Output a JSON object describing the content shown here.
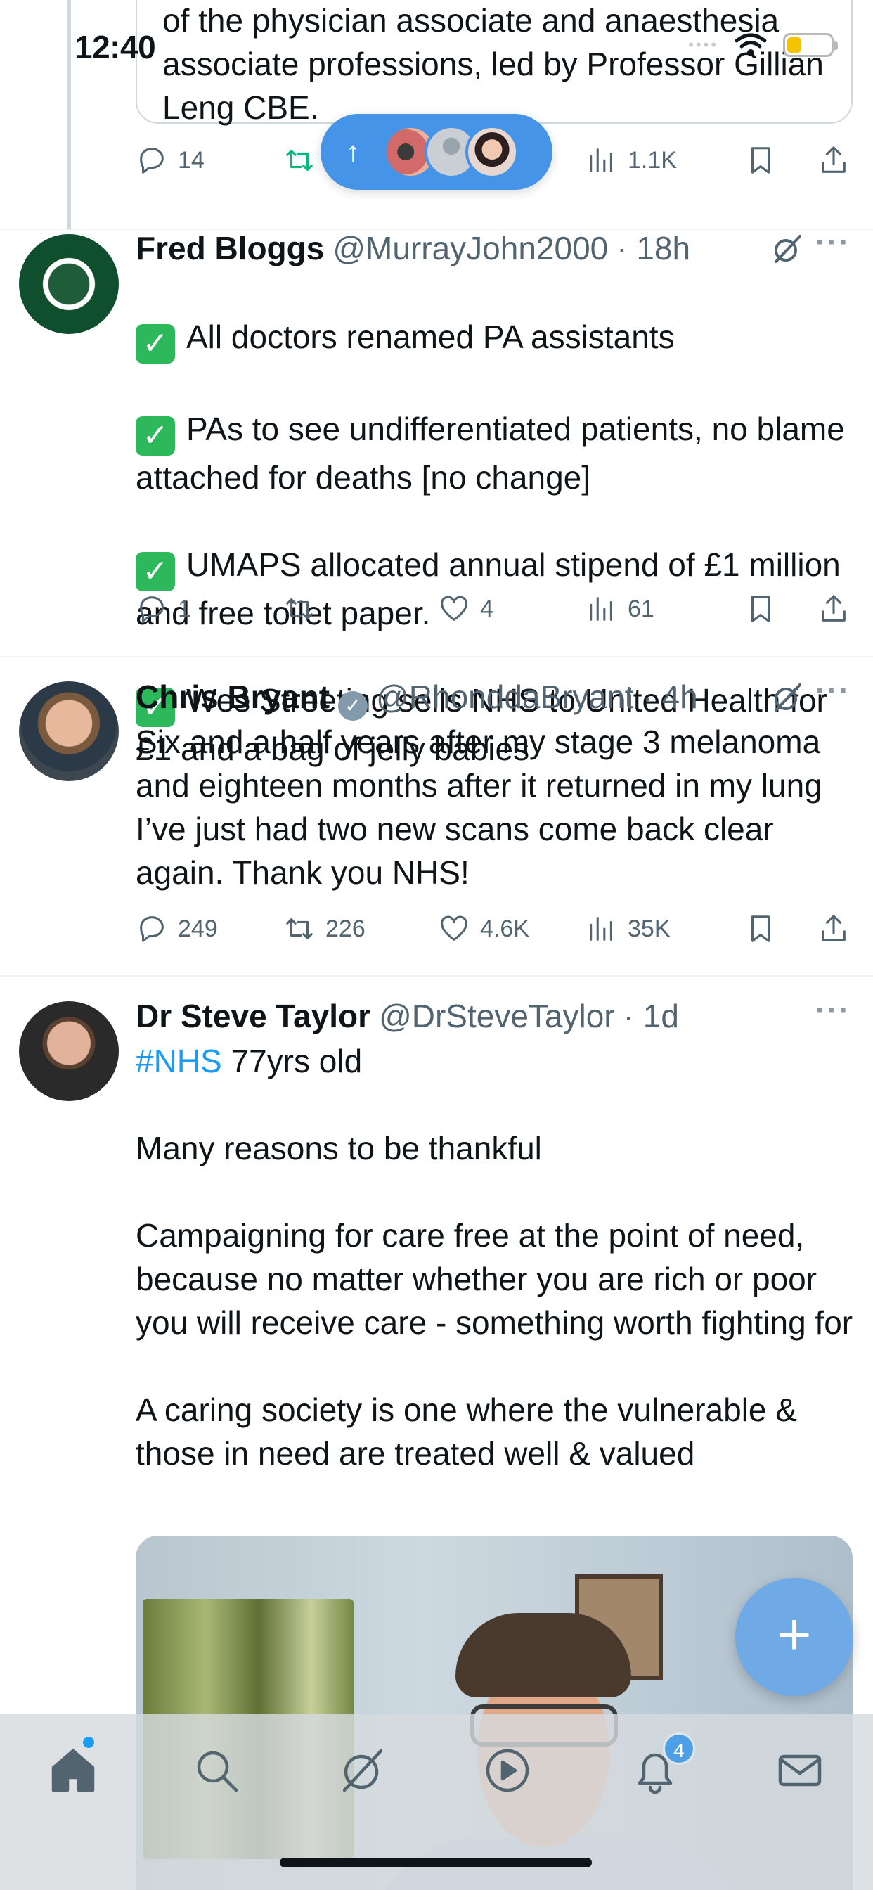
{
  "status_bar": {
    "time": "12:40"
  },
  "quoted_tweet": {
    "text": "of the physician associate and anaesthesia associate professions, led by Professor Gillian Leng CBE."
  },
  "quoted_actions": {
    "replies": "14",
    "views": "1.1K"
  },
  "new_posts_pill": {
    "arrow": "↑"
  },
  "posts": [
    {
      "name": "Fred Bloggs",
      "handle": "@MurrayJohn2000",
      "time": "· 18h",
      "lines": [
        "All doctors renamed PA assistants",
        "PAs to see undifferentiated patients, no blame attached for deaths [no change]",
        "UMAPS allocated annual stipend of £1 million and free toilet paper.",
        "Wes Streeting sells NHS to United Health for £1 and a bag of jelly babies"
      ],
      "replies": "1",
      "retweets": "",
      "likes": "4",
      "views": "61"
    },
    {
      "name": "Chris Bryant",
      "handle": "@RhonddaBryant",
      "time": "· 4h",
      "text": "Six and a half years after my stage 3 melanoma and eighteen months after it returned in my lung I’ve just had two new scans come back clear again. Thank you NHS!",
      "replies": "249",
      "retweets": "226",
      "likes": "4.6K",
      "views": "35K"
    },
    {
      "name": "Dr Steve Taylor",
      "handle": "@DrSteveTaylor",
      "time": "· 1d",
      "hashtag": "#NHS",
      "first_line_rest": " 77yrs old",
      "text": "Many reasons to be thankful\n\nCampaigning for care free at the point of need, because no matter whether you are rich or poor you will receive care - something worth fighting for\n\nA caring society is one where the vulnerable & those in need are treated well & valued"
    }
  ],
  "fab": {
    "label": "+"
  },
  "tabbar": {
    "notifications_badge": "4"
  },
  "colors": {
    "accent": "#1d9bf0",
    "retweet_green": "#00ba7c",
    "muted": "#536471"
  }
}
